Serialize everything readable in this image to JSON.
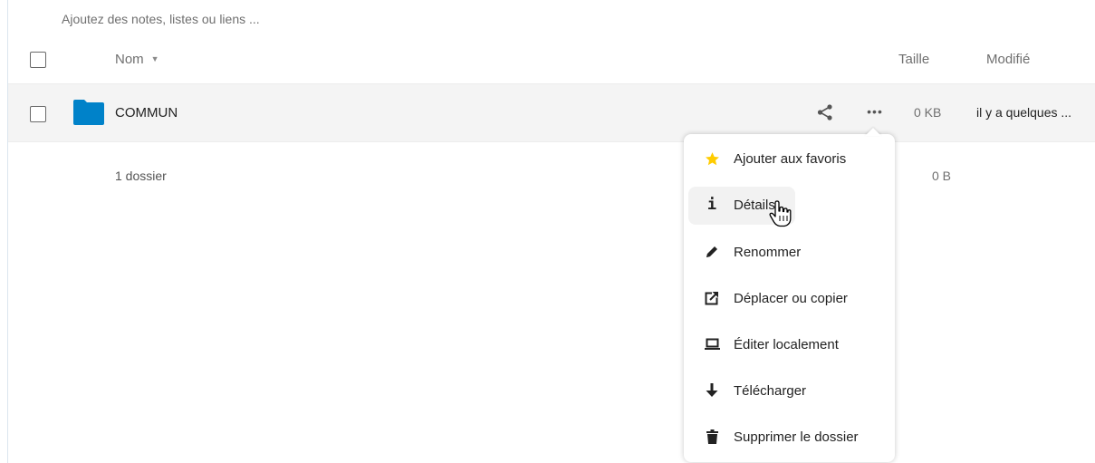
{
  "notes_placeholder": "Ajoutez des notes, listes ou liens ...",
  "header": {
    "name_label": "Nom",
    "sort_icon": "caret-down-icon",
    "size_label": "Taille",
    "modified_label": "Modifié"
  },
  "files": [
    {
      "name": "COMMUN",
      "type": "folder",
      "size": "0 KB",
      "modified": "il y a quelques ...",
      "folder_color": "#0082c9"
    }
  ],
  "summary": {
    "count": "1 dossier",
    "size": "0 B"
  },
  "context_menu": {
    "items": [
      {
        "label": "Ajouter aux favoris",
        "icon": "star-icon",
        "icon_color": "#ffcc00"
      },
      {
        "label": "Détails",
        "icon": "info-icon",
        "hovered": true
      },
      {
        "label": "Renommer",
        "icon": "pencil-icon"
      },
      {
        "label": "Déplacer ou copier",
        "icon": "external-link-icon"
      },
      {
        "label": "Éditer localement",
        "icon": "laptop-icon"
      },
      {
        "label": "Télécharger",
        "icon": "download-icon"
      },
      {
        "label": "Supprimer le dossier",
        "icon": "trash-icon"
      }
    ]
  }
}
